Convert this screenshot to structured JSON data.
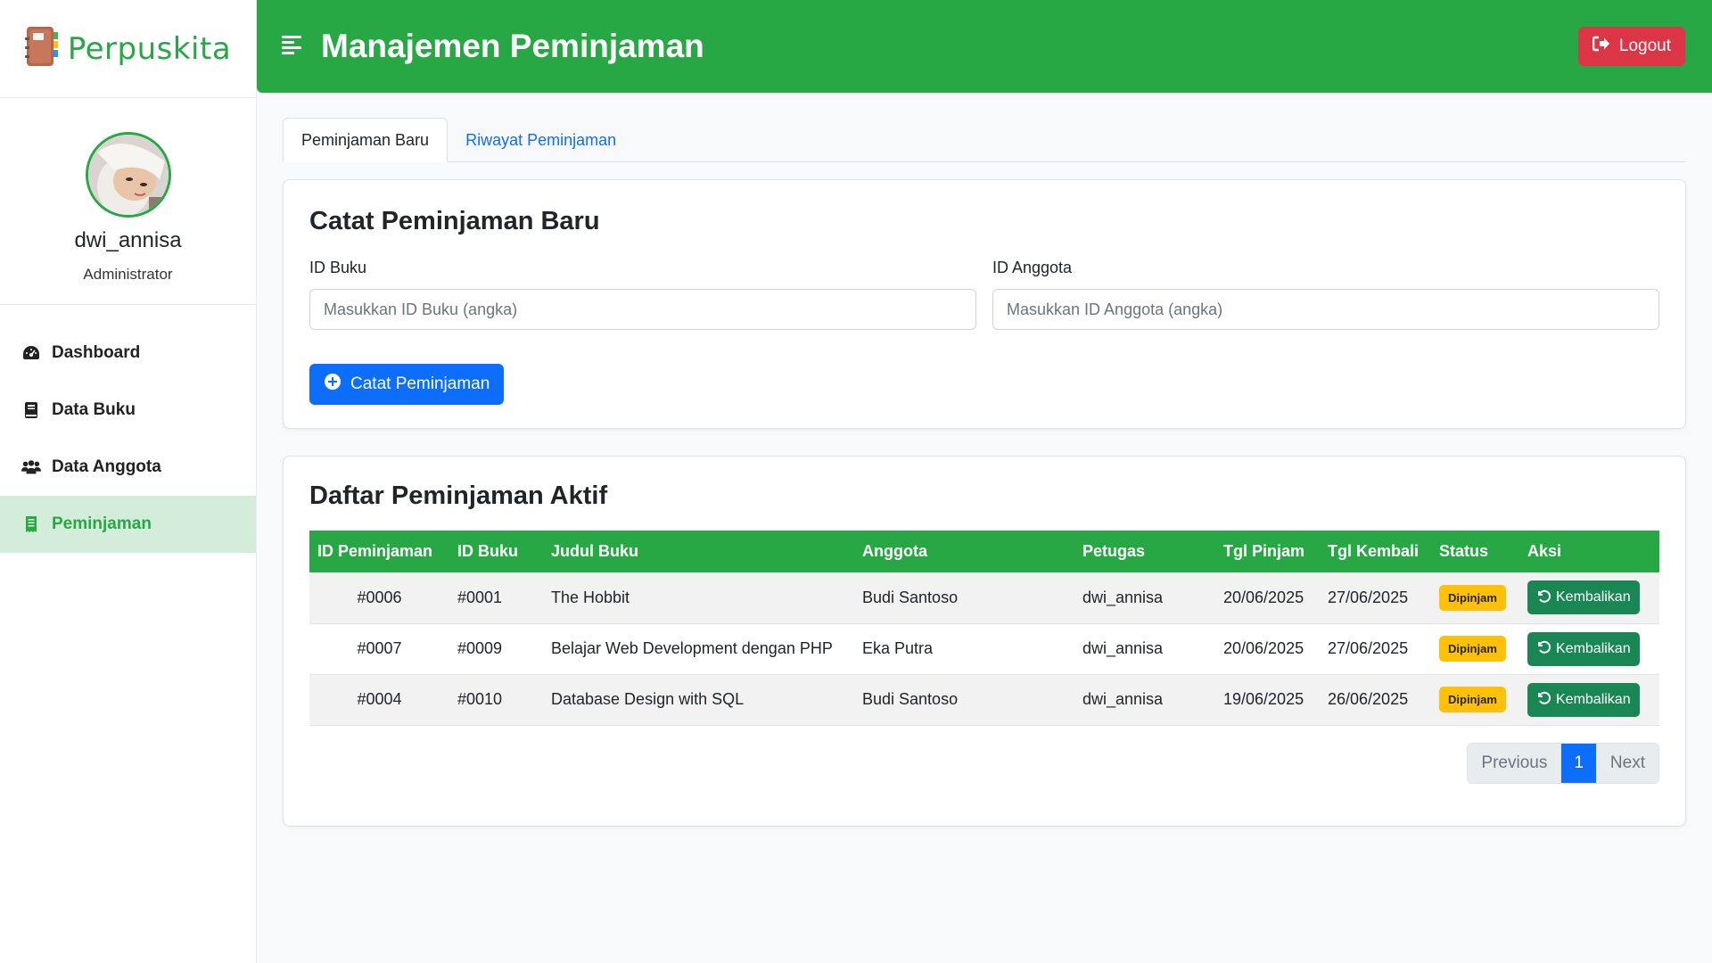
{
  "brand": {
    "name": "Perpuskita"
  },
  "profile": {
    "username": "dwi_annisa",
    "role": "Administrator"
  },
  "sidebar": {
    "items": [
      {
        "label": "Dashboard",
        "icon": "gauge-icon"
      },
      {
        "label": "Data Buku",
        "icon": "book-icon"
      },
      {
        "label": "Data Anggota",
        "icon": "users-icon"
      },
      {
        "label": "Peminjaman",
        "icon": "receipt-icon",
        "active": true
      }
    ]
  },
  "header": {
    "title": "Manajemen Peminjaman",
    "logout_label": "Logout"
  },
  "tabs": [
    {
      "label": "Peminjaman Baru",
      "active": true
    },
    {
      "label": "Riwayat Peminjaman",
      "active": false
    }
  ],
  "new_loan": {
    "title": "Catat Peminjaman Baru",
    "book_label": "ID Buku",
    "book_placeholder": "Masukkan ID Buku (angka)",
    "member_label": "ID Anggota",
    "member_placeholder": "Masukkan ID Anggota (angka)",
    "submit_label": "Catat Peminjaman"
  },
  "active_loans": {
    "title": "Daftar Peminjaman Aktif",
    "columns": [
      "ID Peminjaman",
      "ID Buku",
      "Judul Buku",
      "Anggota",
      "Petugas",
      "Tgl Pinjam",
      "Tgl Kembali",
      "Status",
      "Aksi"
    ],
    "rows": [
      {
        "id": "#0006",
        "book_id": "#0001",
        "title": "The Hobbit",
        "member": "Budi Santoso",
        "officer": "dwi_annisa",
        "borrow_date": "20/06/2025",
        "return_date": "27/06/2025",
        "status": "Dipinjam",
        "action": "Kembalikan"
      },
      {
        "id": "#0007",
        "book_id": "#0009",
        "title": "Belajar Web Development dengan PHP",
        "member": "Eka Putra",
        "officer": "dwi_annisa",
        "borrow_date": "20/06/2025",
        "return_date": "27/06/2025",
        "status": "Dipinjam",
        "action": "Kembalikan"
      },
      {
        "id": "#0004",
        "book_id": "#0010",
        "title": "Database Design with SQL",
        "member": "Budi Santoso",
        "officer": "dwi_annisa",
        "borrow_date": "19/06/2025",
        "return_date": "26/06/2025",
        "status": "Dipinjam",
        "action": "Kembalikan"
      }
    ]
  },
  "pagination": {
    "previous": "Previous",
    "current": "1",
    "next": "Next"
  },
  "colors": {
    "primary_green": "#28a745",
    "danger": "#dc3545",
    "primary_blue": "#0d6efd",
    "warning": "#ffc107",
    "success_dark": "#198754"
  }
}
